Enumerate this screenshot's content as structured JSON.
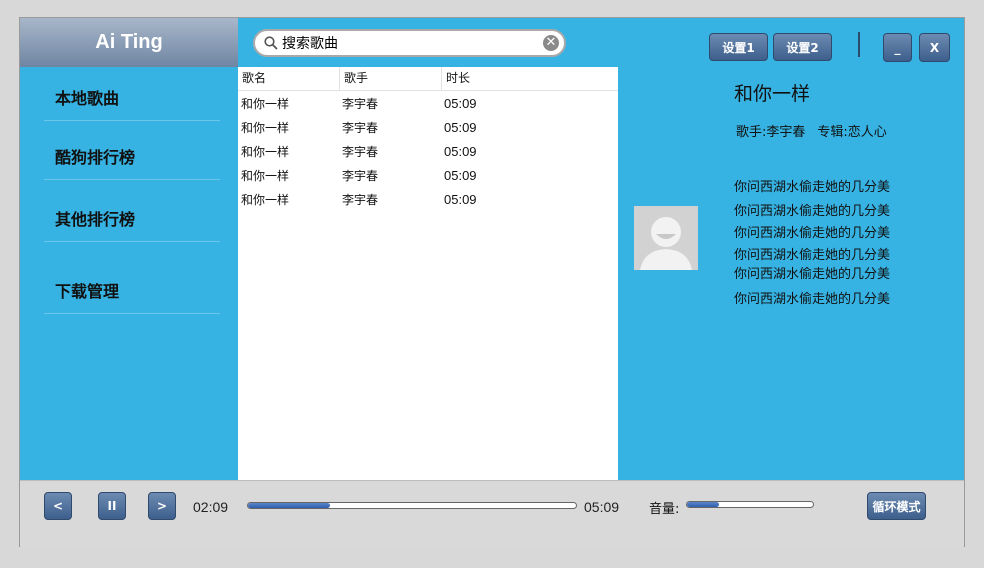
{
  "app": {
    "title": "Ai Ting"
  },
  "search": {
    "value": "搜索歌曲",
    "clear_icon": "clear-icon",
    "search_icon": "search-icon"
  },
  "toolbar": {
    "settings1": "设置1",
    "settings2": "设置2",
    "minimize": "_",
    "close": "X"
  },
  "sidebar": {
    "items": [
      {
        "label": "本地歌曲"
      },
      {
        "label": "酷狗排行榜"
      },
      {
        "label": "其他排行榜"
      },
      {
        "label": "下载管理"
      }
    ]
  },
  "songlist": {
    "columns": [
      "歌名",
      "歌手",
      "时长"
    ],
    "rows": [
      [
        "和你一样",
        "李宇春",
        "05:09"
      ],
      [
        "和你一样",
        "李宇春",
        "05:09"
      ],
      [
        "和你一样",
        "李宇春",
        "05:09"
      ],
      [
        "和你一样",
        "李宇春",
        "05:09"
      ],
      [
        "和你一样",
        "李宇春",
        "05:09"
      ]
    ]
  },
  "detail": {
    "title": "和你一样",
    "singer": "歌手:李宇春",
    "album": "专辑:恋人心",
    "lyrics": [
      "你问西湖水偷走她的几分美",
      "你问西湖水偷走她的几分美",
      "你问西湖水偷走她的几分美",
      "你问西湖水偷走她的几分美",
      "你问西湖水偷走她的几分美",
      "你问西湖水偷走她的几分美"
    ]
  },
  "player": {
    "prev": "<",
    "pause": "II",
    "next": ">",
    "current_time": "02:09",
    "total_time": "05:09",
    "progress_fraction": 0.25,
    "volume_label": "音量:",
    "volume_fraction": 0.25,
    "loop_mode": "循环模式"
  },
  "colors": {
    "panel": "#36b3e3",
    "button": "#4a6d99",
    "background": "#d9d9d9"
  }
}
